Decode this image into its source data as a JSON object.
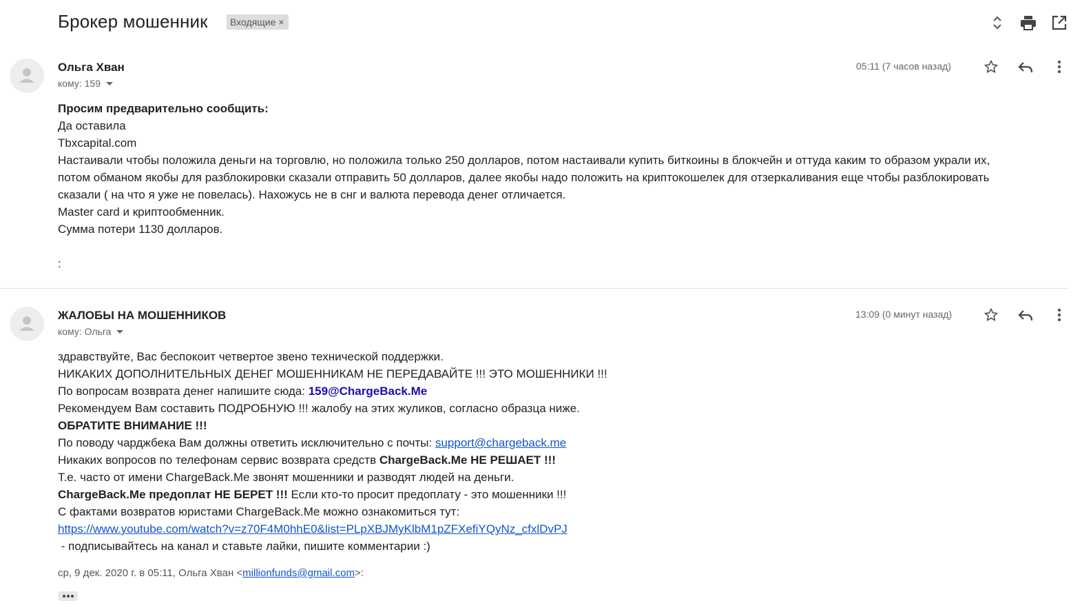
{
  "thread": {
    "subject": "Брокер мошенник",
    "label": "Входящие",
    "label_close": "×",
    "icons": [
      "expand-collapse-icon",
      "print-icon",
      "open-in-new-window-icon"
    ]
  },
  "messages": [
    {
      "sender": "Ольга Хван",
      "to": "кому: 159",
      "timestamp": "05:11 (7 часов назад)",
      "body": {
        "line1": "Просим предварительно сообщить:",
        "line2": "Да оставила",
        "line3": "Tbxcapital.com",
        "line4": "Настаивали чтобы положила деньги на торговлю, но положила только 250 долларов,  потом настаивали купить биткоины в блокчейн и оттуда каким то образом украли их,",
        "line5": "потом обманом якобы для разблокировки сказали отправить 50 долларов, далее якобы надо положить на криптокошелек для отзеркаливания еще чтобы разблокировать",
        "line6": "сказали ( на что я уже не повелась). Нахожусь не в снг и валюта перевода денег  отличается.",
        "line7": "Master card и криптообменник.",
        "line8": "Сумма потери 1130 долларов.",
        "line9": ":"
      }
    },
    {
      "sender": "ЖАЛОБЫ НА МОШЕННИКОВ",
      "to": "кому: Ольга",
      "timestamp": "13:09 (0 минут назад)",
      "body": {
        "line1": "здравствуйте, Вас беспокоит четвертое звено технической поддержки.",
        "line2": "НИКАКИХ ДОПОЛНИТЕЛЬНЫХ ДЕНЕГ МОШЕННИКАМ НЕ ПЕРЕДАВАЙТЕ !!! ЭТО МОШЕННИКИ !!!",
        "line3_prefix": "По вопросам возврата денег напишите сюда: ",
        "line3_link": "159@ChargeBack.Me",
        "line4": "Рекомендуем Вам составить ПОДРОБНУЮ !!! жалобу на этих жуликов, согласно образца ниже.",
        "line5": "ОБРАТИТЕ ВНИМАНИЕ !!!",
        "line6_prefix": "По поводу чарджбека Вам должны ответить исключительно с почты: ",
        "line6_link": "support@chargeback.me",
        "line7_prefix": "Никаких вопросов по телефонам сервис возврата средств ",
        "line7_bold": "ChargeBack.Me НЕ РЕШАЕТ !!!",
        "line8": "Т.е. часто от имени ChargeBack.Me звонят мошенники и разводят людей на деньги.",
        "line9_bold": "ChargeBack.Me предоплат НЕ БЕРЕТ !!!",
        "line9_suffix": " Если кто-то просит предоплату - это мошенники !!!",
        "line10": "С фактами возвратов юристами ChargeBack.Me можно ознакомиться тут:",
        "line11_link": "https://www.youtube.com/watch?v=z70F4M0hhE0&list=PLpXBJMyKlbM1pZFXefiYQyNz_cfxlDvPJ",
        "line12": " - подписывайтесь на канал и ставьте лайки, пишите комментарии :)"
      },
      "quote": {
        "prefix": "ср, 9 дек. 2020 г. в 05:11, Ольга Хван <",
        "email": "millionfunds@gmail.com",
        "suffix": ">:"
      }
    }
  ],
  "colors": {
    "link": "#1155cc",
    "link_bold": "#1a0dab",
    "label_bg": "#dddddd",
    "avatar_bg": "#eeeeee",
    "avatar_fg": "#c5c5c5"
  }
}
